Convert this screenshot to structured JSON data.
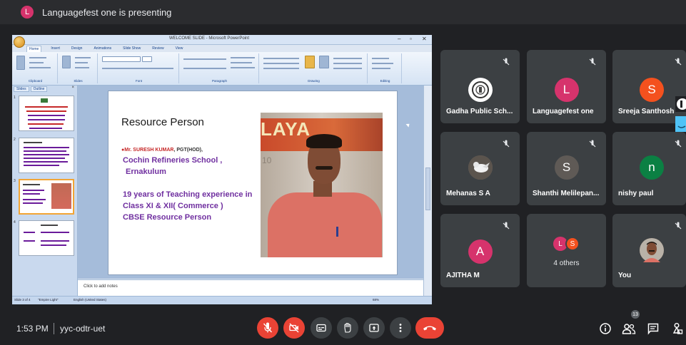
{
  "banner": {
    "presenter_initial": "L",
    "text": "Languagefest one is presenting",
    "avatar_color": "#d6336c"
  },
  "shared_screen": {
    "window_title": "WELCOME SLIDE - Microsoft PowerPoint",
    "ribbon_tabs": [
      "Home",
      "Insert",
      "Design",
      "Animations",
      "Slide Show",
      "Review",
      "View"
    ],
    "ribbon_groups": [
      "Clipboard",
      "Slides",
      "Font",
      "Paragraph",
      "Drawing",
      "Editing"
    ],
    "pane_tabs": [
      "Slides",
      "Outline"
    ],
    "slide": {
      "title": "Resource Person",
      "name_prefix": "Mr. SURESH KUMAR",
      "name_suffix": ", PGT(HOD),",
      "school_line1": "Cochin Refineries School ,",
      "school_line2": "Ernakulum",
      "exp_line1": "19 years  of Teaching experience in",
      "exp_line2": "Class XI & XII( Commerce )",
      "exp_line3": "CBSE Resource Person",
      "photo_sign_text": "LAYA",
      "photo_side_text": "10"
    },
    "notes_placeholder": "Click to add notes",
    "status_slide": "Slide 3 of 4",
    "status_theme": "\"Empire Light\"",
    "status_language": "English (United States)",
    "status_zoom": "68%"
  },
  "participants": [
    {
      "name": "Gadha Public Sch...",
      "avatar_type": "logo",
      "initial": "",
      "color": "#ffffff",
      "muted": true
    },
    {
      "name": "Languagefest one",
      "avatar_type": "letter",
      "initial": "L",
      "color": "#d6336c",
      "muted": true
    },
    {
      "name": "Sreeja Santhosh",
      "avatar_type": "letter",
      "initial": "S",
      "color": "#f4511e",
      "muted": true
    },
    {
      "name": "Mehanas S A",
      "avatar_type": "photo",
      "initial": "",
      "color": "#7a7066",
      "muted": true
    },
    {
      "name": "Shanthi Melilepan...",
      "avatar_type": "letter",
      "initial": "S",
      "color": "#5f5a56",
      "muted": true
    },
    {
      "name": "nishy paul",
      "avatar_type": "letter",
      "initial": "n",
      "color": "#0b8043",
      "muted": true
    },
    {
      "name": "AJITHA M",
      "avatar_type": "letter",
      "initial": "A",
      "color": "#d6336c",
      "muted": true
    },
    {
      "name": "",
      "others_label": "4 others",
      "mini_initials": [
        "L",
        "S"
      ],
      "mini_colors": [
        "#d6336c",
        "#f4511e"
      ],
      "muted": false
    },
    {
      "name": "You",
      "avatar_type": "photo",
      "initial": "",
      "color": "#6b4b38",
      "muted": true
    }
  ],
  "bottom_bar": {
    "time": "1:53 PM",
    "meeting_code": "yyc-odtr-uet",
    "participant_count": "13",
    "controls": [
      "mic-off",
      "camera-off",
      "captions",
      "raise-hand",
      "present",
      "more-options",
      "leave-call"
    ],
    "right_controls": [
      "meeting-details",
      "people",
      "chat",
      "activities"
    ]
  }
}
